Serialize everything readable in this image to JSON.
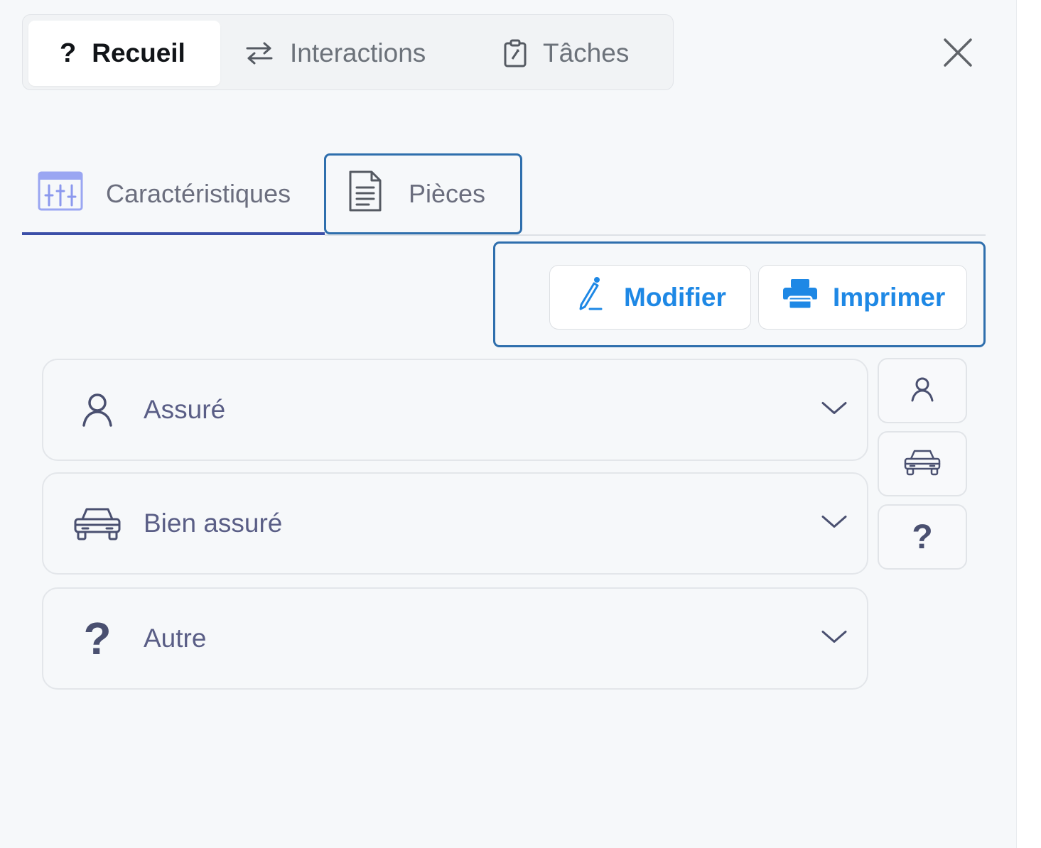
{
  "top_tabs": [
    {
      "icon": "question-icon",
      "label": "Recueil",
      "glyph": "?"
    },
    {
      "icon": "swap-arrows-icon",
      "label": "Interactions"
    },
    {
      "icon": "clipboard-icon",
      "label": "Tâches"
    }
  ],
  "active_top_tab": "Recueil",
  "section_tabs": [
    {
      "icon": "sliders-icon",
      "label": "Caractéristiques"
    },
    {
      "icon": "document-icon",
      "label": "Pièces"
    }
  ],
  "active_section_tab": "Caractéristiques",
  "actions": {
    "modifier_label": "Modifier",
    "imprimer_label": "Imprimer"
  },
  "cards": [
    {
      "icon": "person-icon",
      "label": "Assuré"
    },
    {
      "icon": "car-icon",
      "label": "Bien assuré"
    },
    {
      "icon": "question-icon",
      "label": "Autre",
      "glyph": "?"
    }
  ],
  "side_buttons": [
    {
      "icon": "person-icon"
    },
    {
      "icon": "car-icon"
    },
    {
      "icon": "question-icon",
      "glyph": "?"
    }
  ],
  "colors": {
    "accent_blue": "#1e88e5",
    "active_underline": "#3b4fa8",
    "highlight_border": "#2f6fad",
    "label_text": "#5a5e86"
  }
}
